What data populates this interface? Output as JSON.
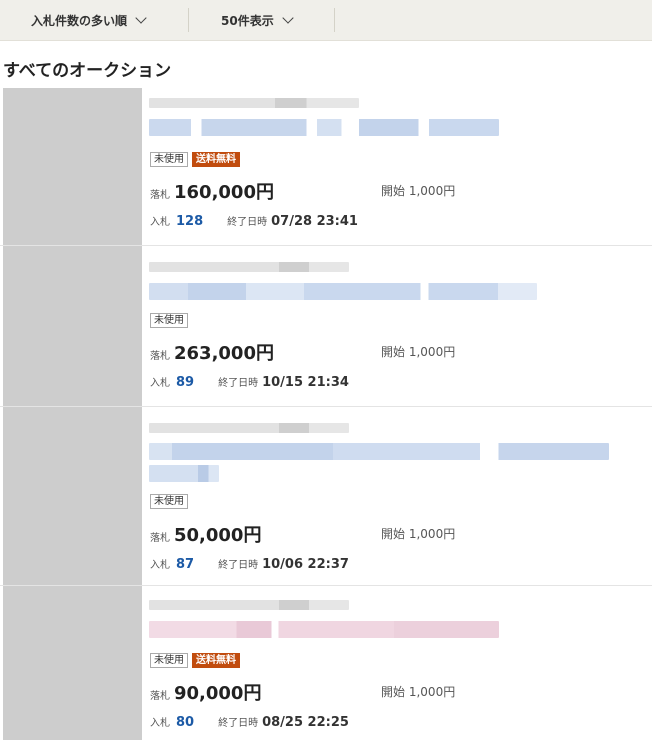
{
  "toolbar": {
    "sort_label": "入札件数の多い順",
    "count_label": "50件表示"
  },
  "section_title": "すべてのオークション",
  "items": [
    {
      "tags": [
        "未使用",
        "送料無料"
      ],
      "price_label": "落札",
      "price": "160,000円",
      "start_label": "開始",
      "start_price": "1,000円",
      "bids_label": "入札",
      "bids": "128",
      "end_label": "終了日時",
      "end_time": "07/28 23:41"
    },
    {
      "tags": [
        "未使用"
      ],
      "price_label": "落札",
      "price": "263,000円",
      "start_label": "開始",
      "start_price": "1,000円",
      "bids_label": "入札",
      "bids": "89",
      "end_label": "終了日時",
      "end_time": "10/15 21:34"
    },
    {
      "tags": [
        "未使用"
      ],
      "price_label": "落札",
      "price": "50,000円",
      "start_label": "開始",
      "start_price": "1,000円",
      "bids_label": "入札",
      "bids": "87",
      "end_label": "終了日時",
      "end_time": "10/06 22:37"
    },
    {
      "tags": [
        "未使用",
        "送料無料"
      ],
      "price_label": "落札",
      "price": "90,000円",
      "start_label": "開始",
      "start_price": "1,000円",
      "bids_label": "入札",
      "bids": "80",
      "end_label": "終了日時",
      "end_time": "08/25 22:25"
    }
  ],
  "colors": {
    "toolbar_bg": "#f0efea",
    "thumb_placeholder": "#cdcdcd",
    "free_shipping_tag": "#c14c0e",
    "bid_count": "#1c5aa6",
    "blurred_title_blue": "#c9d8ee",
    "blurred_title_pink": "#efd8e2"
  },
  "icons": {
    "sort_dropdown": "chevron-down-icon",
    "count_dropdown": "chevron-down-icon"
  }
}
